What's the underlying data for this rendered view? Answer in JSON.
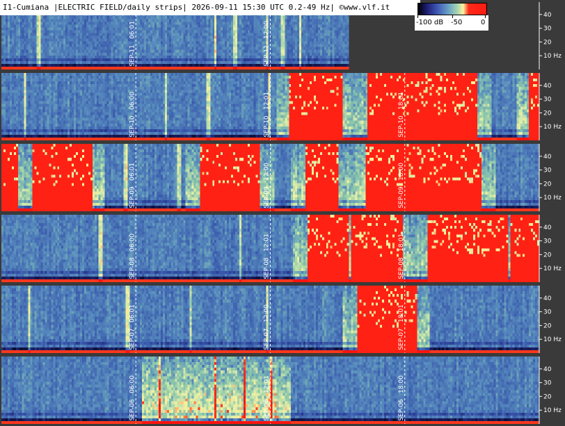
{
  "header": {
    "title": "I1-Cumiana |ELECTRIC FIELD/daily strips| 2026-09-11 15:30 UTC 0.2-49 Hz| ©www.vlf.it"
  },
  "colorbar": {
    "ticks": [
      "-100 dB",
      "-50",
      "0"
    ],
    "colors": [
      "#000000",
      "#1b1b6e",
      "#3d57b6",
      "#6ca4c4",
      "#a9d9b0",
      "#fff2a0",
      "#ff2a1a"
    ]
  },
  "chart_data": {
    "type": "heatmap",
    "ytick_labels": [
      "40",
      "30",
      "20",
      "10 Hz"
    ],
    "yticks": [
      40,
      30,
      20,
      10
    ],
    "ylim": [
      0,
      49
    ],
    "xlim_hours": [
      0,
      24
    ],
    "strips": [
      {
        "date": "SEP-11",
        "markers": [
          {
            "hour": 6,
            "label": "06:01"
          },
          {
            "hour": 12,
            "label": "12:00"
          }
        ],
        "data_until_hour": 15.5,
        "saturated": [],
        "spikes": [
          1.6,
          9.5,
          10.4,
          11.8,
          12.5,
          13.3
        ]
      },
      {
        "date": "SEP-10",
        "markers": [
          {
            "hour": 6,
            "label": "06:00"
          },
          {
            "hour": 12,
            "label": "12:01"
          },
          {
            "hour": 18,
            "label": "18:01"
          }
        ],
        "data_until_hour": 24,
        "saturated": [
          [
            12.8,
            15.2
          ],
          [
            16.3,
            21.2
          ],
          [
            23.5,
            24
          ]
        ],
        "spikes": [
          1.0,
          7.3,
          9.2,
          11.9
        ]
      },
      {
        "date": "SEP-09",
        "markers": [
          {
            "hour": 6,
            "label": "06:01"
          },
          {
            "hour": 12,
            "label": "12:00"
          },
          {
            "hour": 18,
            "label": "18:00"
          }
        ],
        "data_until_hour": 24,
        "saturated": [
          [
            0.0,
            0.7
          ],
          [
            1.3,
            4.0
          ],
          [
            8.8,
            11.5
          ],
          [
            13.5,
            15.0
          ],
          [
            16.2,
            21.4
          ]
        ],
        "spikes": [
          5.5,
          7.9
        ]
      },
      {
        "date": "SEP-08",
        "markers": [
          {
            "hour": 6,
            "label": "06:00"
          },
          {
            "hour": 12,
            "label": "12:01"
          },
          {
            "hour": 18,
            "label": "18:01"
          }
        ],
        "data_until_hour": 24,
        "saturated": [
          [
            13.6,
            15.5
          ],
          [
            15.6,
            17.9
          ],
          [
            19.0,
            22.6
          ],
          [
            22.7,
            24
          ]
        ],
        "spikes": [
          4.4,
          10.6
        ]
      },
      {
        "date": "SEP-07",
        "markers": [
          {
            "hour": 6,
            "label": "06:01"
          },
          {
            "hour": 12,
            "label": "12:00"
          },
          {
            "hour": 18,
            "label": "18:01"
          }
        ],
        "data_until_hour": 24,
        "saturated": [
          [
            15.8,
            18.5
          ]
        ],
        "spikes": [
          1.2,
          5.6,
          8.4,
          11.8
        ]
      },
      {
        "date": "SEP-06",
        "markers": [
          {
            "hour": 6,
            "label": "06:00"
          },
          {
            "hour": 12,
            "label": "12:01"
          },
          {
            "hour": 18,
            "label": "18:00"
          }
        ],
        "data_until_hour": 24,
        "saturated": [],
        "activity": [
          6.2,
          12.9
        ],
        "spikes": [
          7.0,
          9.5,
          10.8,
          12.0
        ]
      }
    ]
  }
}
